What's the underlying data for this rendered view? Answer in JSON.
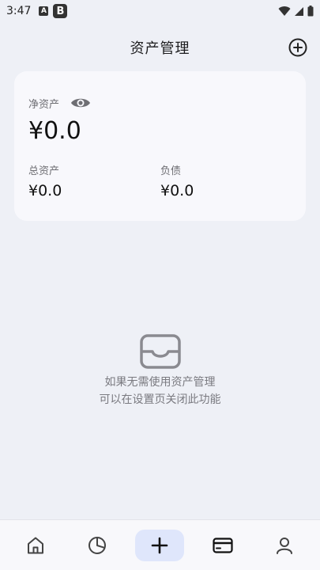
{
  "status_bar": {
    "time": "3:47",
    "icon_a": "A",
    "icon_b": "B"
  },
  "header": {
    "title": "资产管理"
  },
  "summary": {
    "net_label": "净资产",
    "net_value": "¥0.0",
    "total_assets_label": "总资产",
    "total_assets_value": "¥0.0",
    "liabilities_label": "负债",
    "liabilities_value": "¥0.0"
  },
  "empty_state": {
    "line1": "如果无需使用资产管理",
    "line2": "可以在设置页关闭此功能"
  },
  "bottom_nav": {
    "items": [
      "home-icon",
      "pie-chart-icon",
      "plus-icon",
      "card-icon",
      "user-icon"
    ]
  },
  "colors": {
    "background": "#eef0f6",
    "card": "#f8f8fc",
    "nav_add_bg": "#dfe6fb",
    "muted_text": "#6e6e73"
  }
}
